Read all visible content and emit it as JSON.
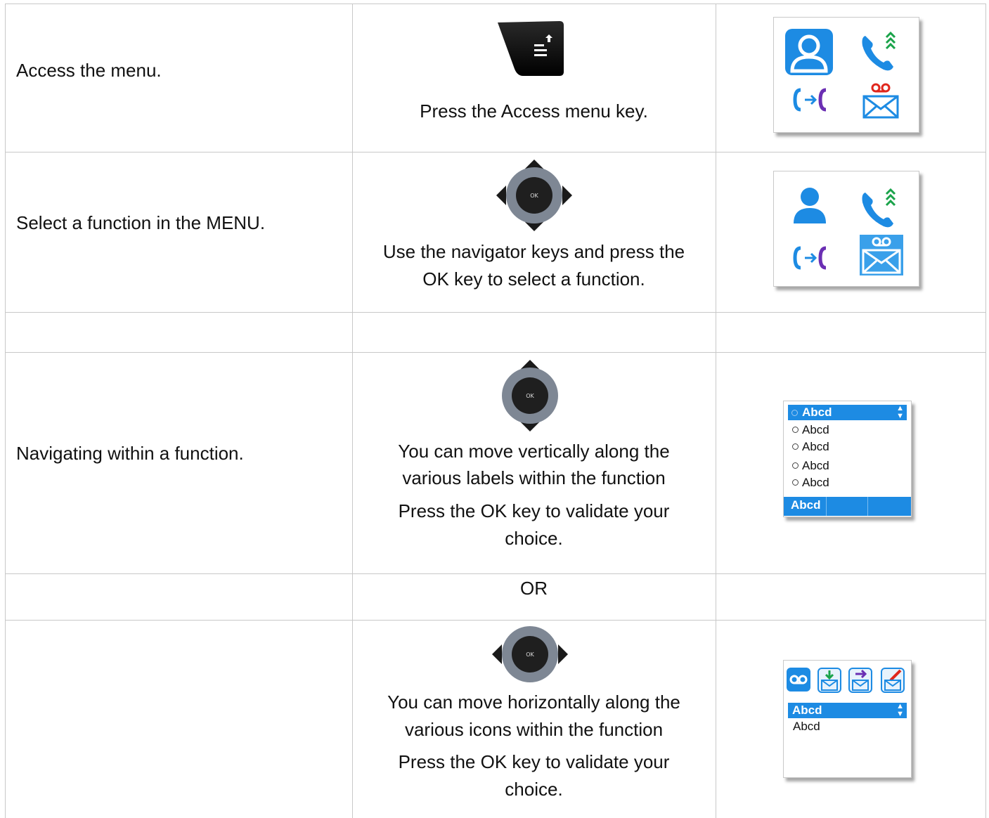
{
  "rows": [
    {
      "action": "Access the menu.",
      "instruction": "Press the Access menu key.",
      "key_icon": "access-menu-key-icon",
      "screen": {
        "icons": [
          "contact-icon",
          "call-log-icon",
          "transfer-icon",
          "voicemail-icon"
        ]
      }
    },
    {
      "action": "Select a function in the MENU.",
      "instruction_lines": [
        "Use the navigator keys and press the",
        "OK key to select a function."
      ],
      "key_icon": "navigator-key-icon",
      "nav_ok_label": "OK",
      "screen": {
        "icons": [
          "contact-icon",
          "call-log-icon",
          "transfer-icon",
          "voicemail-icon"
        ]
      }
    },
    {
      "action": "Navigating within a function.",
      "instruction_lines": [
        "You can move vertically along the",
        "various labels within the function"
      ],
      "validate_lines": [
        "Press the OK key to validate your",
        "choice."
      ],
      "key_icon": "navigator-vertical-icon",
      "nav_ok_label": "OK",
      "screen": {
        "selected": "Abcd",
        "items": [
          "Abcd",
          "Abcd",
          "Abcd",
          "Abcd"
        ],
        "footer": "Abcd"
      }
    },
    {
      "separator": "OR"
    },
    {
      "action": "",
      "instruction_lines": [
        "You can move horizontally along the",
        "various icons within the function"
      ],
      "validate_lines": [
        "Press the OK key to validate your",
        "choice."
      ],
      "key_icon": "navigator-horizontal-icon",
      "nav_ok_label": "OK",
      "screen": {
        "tab_icons": [
          "voicemail-tab-icon",
          "inbox-icon",
          "forward-mail-icon",
          "compose-mail-icon"
        ],
        "selected": "Abcd",
        "items": [
          "Abcd"
        ]
      }
    }
  ],
  "colors": {
    "accent": "#1d8be3",
    "purple": "#6b2fb3",
    "green": "#1aa34a",
    "red": "#e0261c",
    "border": "#c8c8c8"
  }
}
